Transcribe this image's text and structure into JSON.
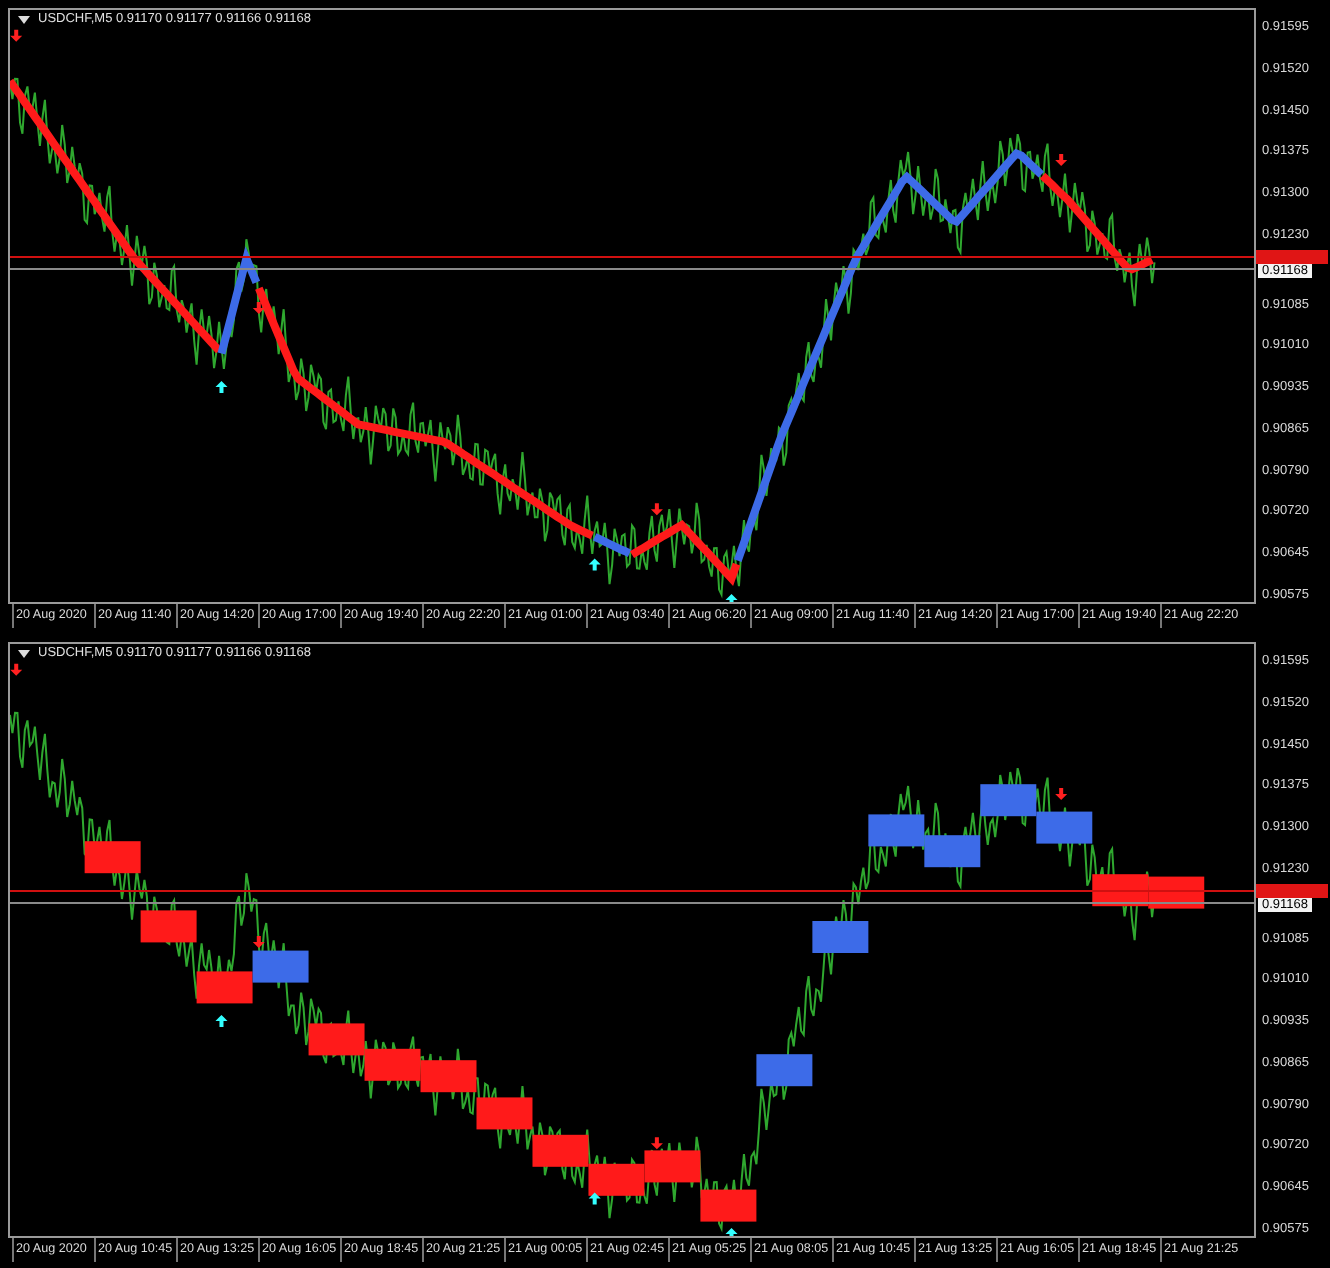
{
  "charts": [
    {
      "header": "USDCHF,M5  0.91170 0.91177 0.91166 0.91168",
      "kind": "line",
      "current_price": "0.91168",
      "price_labels": [
        "0.91595",
        "0.91520",
        "0.91450",
        "0.91375",
        "0.91300",
        "0.91230",
        "0.91085",
        "0.91010",
        "0.90935",
        "0.90865",
        "0.90790",
        "0.90720",
        "0.90645",
        "0.90575"
      ],
      "time_labels": [
        "20 Aug 2020",
        "20 Aug 11:40",
        "20 Aug 14:20",
        "20 Aug 17:00",
        "20 Aug 19:40",
        "20 Aug 22:20",
        "21 Aug 01:00",
        "21 Aug 03:40",
        "21 Aug 06:20",
        "21 Aug 09:00",
        "21 Aug 11:40",
        "21 Aug 14:20",
        "21 Aug 17:00",
        "21 Aug 19:40",
        "21 Aug 22:20"
      ]
    },
    {
      "header": "USDCHF,M5  0.91170 0.91177 0.91166 0.91168",
      "kind": "blocks",
      "current_price": "0.91168",
      "price_labels": [
        "0.91595",
        "0.91520",
        "0.91450",
        "0.91375",
        "0.91300",
        "0.91230",
        "0.91085",
        "0.91010",
        "0.90935",
        "0.90865",
        "0.90790",
        "0.90720",
        "0.90645",
        "0.90575"
      ],
      "time_labels": [
        "20 Aug 2020",
        "20 Aug 10:45",
        "20 Aug 13:25",
        "20 Aug 16:05",
        "20 Aug 18:45",
        "20 Aug 21:25",
        "21 Aug 00:05",
        "21 Aug 02:45",
        "21 Aug 05:25",
        "21 Aug 08:05",
        "21 Aug 10:45",
        "21 Aug 13:25",
        "21 Aug 16:05",
        "21 Aug 18:45",
        "21 Aug 21:25"
      ]
    }
  ]
}
